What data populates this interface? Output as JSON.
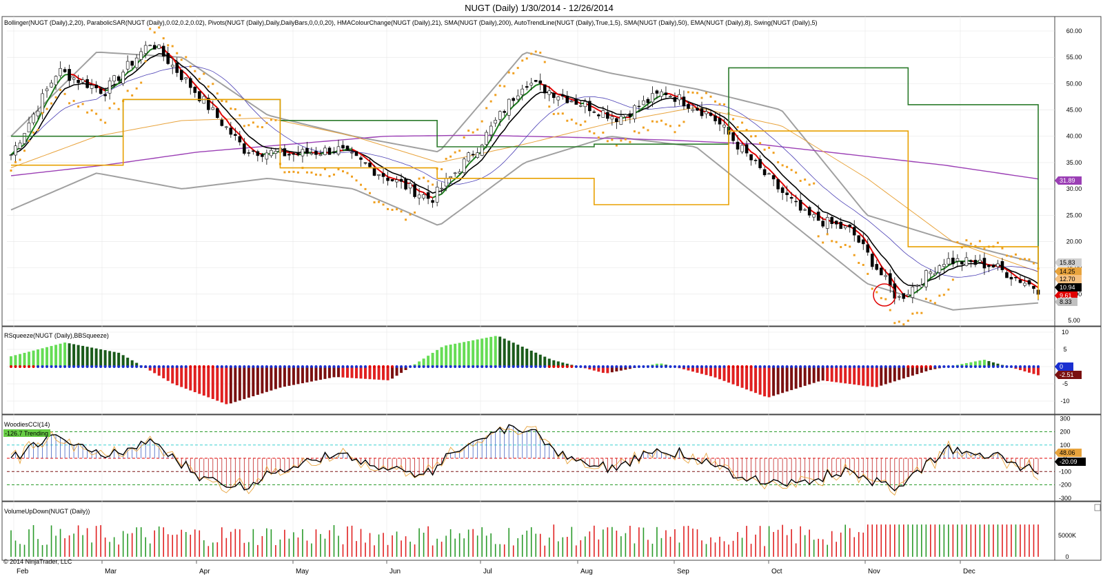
{
  "title": "NUGT (Daily)  1/30/2014 - 12/26/2014",
  "copyright": "© 2014 NinjaTrader, LLC",
  "colors": {
    "candle_up": "#ffffff",
    "candle_down": "#000000",
    "sma50": "#e8a33c",
    "sma200": "#9b3fb5",
    "sma20": "#4a3fb5",
    "ema8": "#000000",
    "hma_up": "#1a7a1a",
    "hma_down": "#e00000",
    "bollinger": "#a0a0a0",
    "psar": "#f0a020",
    "pivot_high": "#2a7a2a",
    "pivot_low": "#e8a000",
    "squeeze_up_bright": "#66dd55",
    "squeeze_up_dark": "#1a5a1a",
    "squeeze_down_bright": "#e02020",
    "squeeze_down_dark": "#7a1010",
    "cci_line": "#000000",
    "cci_turbo": "#e8a33c",
    "vol_up": "#2a9a2a",
    "vol_down": "#e02020"
  },
  "panels": {
    "price": {
      "label": "Bollinger(NUGT (Daily),2,20), ParabolicSAR(NUGT (Daily),0.02,0.2,0.02), Pivots(NUGT (Daily),Daily,DailyBars,0,0,0,20), HMAColourChange(NUGT (Daily),21), SMA(NUGT (Daily),200), AutoTrendLine(NUGT (Daily),True,1,5), SMA(NUGT (Daily),50), EMA(NUGT (Daily),8), Swing(NUGT (Daily),5)",
      "yticks": [
        "60.00",
        "55.00",
        "50.00",
        "45.00",
        "40.00",
        "35.00",
        "30.00",
        "25.00",
        "20.00",
        "15.00",
        "10.00",
        "5.00"
      ],
      "badges": [
        {
          "text": "31.89",
          "value": 31.89,
          "bg": "#9b3fb5",
          "fg": "#ffffff"
        },
        {
          "text": "15.83",
          "value": 15.83,
          "bg": "#d0d0d0",
          "fg": "#000000"
        },
        {
          "text": "14.25",
          "value": 14.25,
          "bg": "#e8a33c",
          "fg": "#000000"
        },
        {
          "text": "12.70",
          "value": 12.7,
          "bg": "#f4c080",
          "fg": "#000000"
        },
        {
          "text": "10.94",
          "value": 10.94,
          "bg": "#000000",
          "fg": "#ffffff"
        },
        {
          "text": "9.61",
          "value": 9.61,
          "bg": "#e00000",
          "fg": "#ffffff"
        },
        {
          "text": "8.33",
          "value": 8.33,
          "bg": "#c0c0c0",
          "fg": "#000000"
        }
      ]
    },
    "squeeze": {
      "label": "RSqueeze(NUGT (Daily),BBSqueeze)",
      "yticks": [
        "10",
        "5",
        "0",
        "-5",
        "-10"
      ],
      "badges": [
        {
          "text": "0",
          "value": 0,
          "bg": "#1a2fd0",
          "fg": "#ffffff"
        },
        {
          "text": "-2.51",
          "value": -2.51,
          "bg": "#7a1010",
          "fg": "#ffffff"
        }
      ]
    },
    "cci": {
      "label": "WoodiesCCI(14)",
      "status": "-126.7 Trending",
      "yticks": [
        "300",
        "200",
        "100",
        "0",
        "-100",
        "-200",
        "-300"
      ],
      "badges": [
        {
          "text": "48.06",
          "value": 48.06,
          "bg": "#e8a33c",
          "fg": "#000000"
        },
        {
          "text": "-20.09",
          "value": -20.09,
          "bg": "#000000",
          "fg": "#ffffff"
        }
      ]
    },
    "volume": {
      "label": "VolumeUpDown(NUGT (Daily))",
      "yticks": [
        "5000K",
        "0"
      ]
    }
  },
  "xaxis": {
    "months": [
      "Feb",
      "Mar",
      "Apr",
      "May",
      "Jun",
      "Jul",
      "Aug",
      "Sep",
      "Oct",
      "Nov",
      "Dec"
    ]
  },
  "chart_data": {
    "type": "line",
    "title": "NUGT (Daily)  1/30/2014 - 12/26/2014",
    "x_start": "2014-01-30",
    "x_end": "2014-12-26",
    "ylim": [
      5,
      60
    ],
    "bars_per_month": 21,
    "close_keypoints": {
      "x_month": [
        "Feb",
        "Feb",
        "Mar",
        "Mar",
        "Mar",
        "Apr",
        "Apr",
        "May",
        "May",
        "Jun",
        "Jun",
        "Jul",
        "Jul",
        "Aug",
        "Aug",
        "Sep",
        "Sep",
        "Oct",
        "Oct",
        "Nov",
        "Nov",
        "Dec",
        "Dec"
      ],
      "values": [
        36.5,
        52.5,
        48.5,
        58.0,
        48.0,
        37.5,
        36.5,
        37.5,
        32.5,
        28.0,
        38.0,
        50.5,
        47.0,
        43.5,
        48.5,
        44.0,
        34.0,
        25.0,
        22.0,
        9.0,
        16.5,
        15.5,
        11.0
      ]
    },
    "series": [
      {
        "name": "SMA(NUGT (Daily),200)",
        "keypoints": [
          32.5,
          34.5,
          37.0,
          38.5,
          40.0,
          40.2,
          39.8,
          39.3,
          38.5,
          36.5,
          34.5,
          31.89
        ]
      },
      {
        "name": "SMA(NUGT (Daily),50)",
        "keypoints": [
          34.0,
          40.0,
          43.0,
          43.5,
          40.0,
          35.0,
          38.5,
          42.5,
          45.5,
          42.0,
          32.0,
          20.0,
          14.25
        ]
      },
      {
        "name": "Bollinger(NUGT (Daily),2,20)",
        "upper_keypoints": [
          40,
          56,
          55,
          44,
          40,
          37,
          56,
          52,
          49,
          45,
          25,
          20,
          15.83
        ],
        "lower_keypoints": [
          26,
          33,
          30,
          32,
          30,
          23,
          35,
          40,
          38,
          25,
          12,
          7,
          8.33
        ]
      }
    ],
    "squeeze_keypoints": {
      "values": [
        3,
        7,
        4,
        -5,
        -11,
        -6,
        -3,
        -4,
        6,
        9,
        2,
        -2,
        1,
        -3,
        -9,
        -4,
        -6,
        -1,
        2,
        -2.51
      ]
    },
    "volume_max_k": 8000,
    "volume_axis_tick_k": 5000
  }
}
